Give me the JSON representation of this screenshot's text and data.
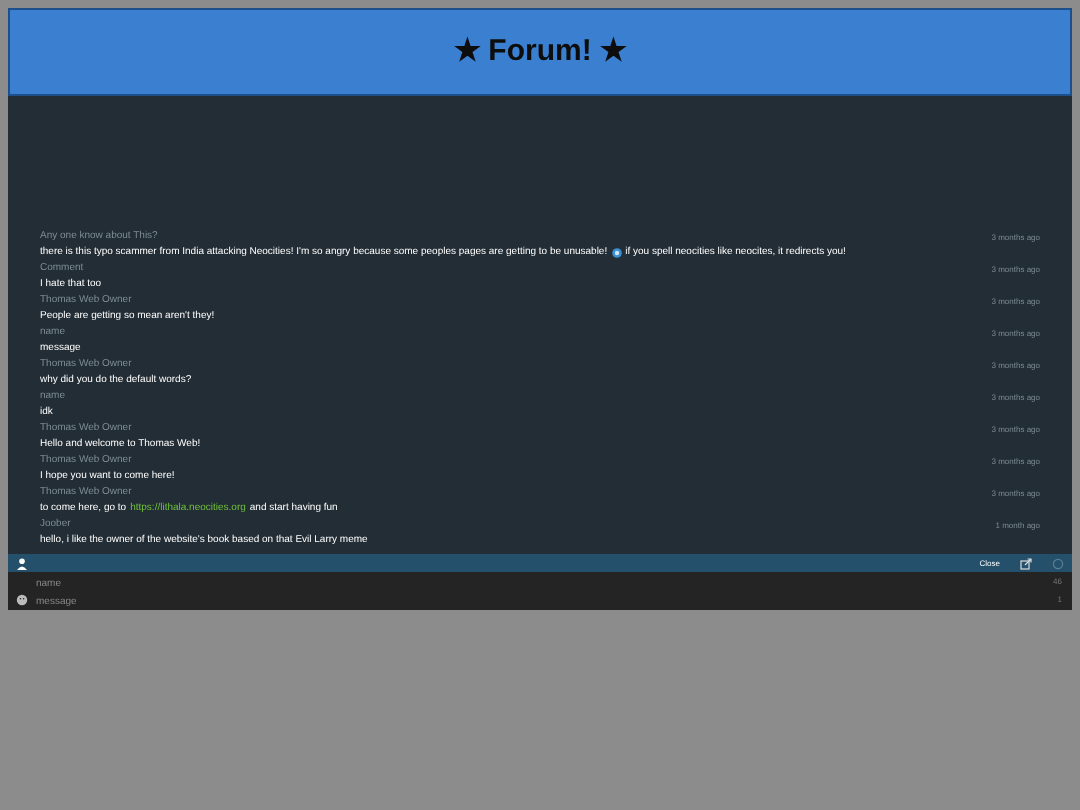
{
  "header": {
    "title": "★ Forum! ★"
  },
  "messages": [
    {
      "author": "Any one know about This?",
      "time": "3 months ago",
      "parts": [
        {
          "kind": "text",
          "text": "there is this typo scammer from India attacking Neocities! I'm so angry because some peoples pages are getting to be unusable!"
        },
        {
          "kind": "emoji"
        },
        {
          "kind": "text",
          "text": "if you spell neocities like neocites, it redirects you!"
        }
      ]
    },
    {
      "author": "Comment",
      "time": "3 months ago",
      "parts": [
        {
          "kind": "text",
          "text": "I hate that too"
        }
      ]
    },
    {
      "author": "Thomas Web Owner",
      "time": "3 months ago",
      "parts": [
        {
          "kind": "text",
          "text": "People are getting so mean aren't they!"
        }
      ]
    },
    {
      "author": "name",
      "time": "3 months ago",
      "parts": [
        {
          "kind": "text",
          "text": "message"
        }
      ]
    },
    {
      "author": "Thomas Web Owner",
      "time": "3 months ago",
      "parts": [
        {
          "kind": "text",
          "text": "why did you do the default words?"
        }
      ]
    },
    {
      "author": "name",
      "time": "3 months ago",
      "parts": [
        {
          "kind": "text",
          "text": "idk"
        }
      ]
    },
    {
      "author": "Thomas Web Owner",
      "time": "3 months ago",
      "parts": [
        {
          "kind": "text",
          "text": "Hello and welcome to Thomas Web!"
        }
      ]
    },
    {
      "author": "Thomas Web Owner",
      "time": "3 months ago",
      "parts": [
        {
          "kind": "text",
          "text": "I hope you want to come here!"
        }
      ]
    },
    {
      "author": "Thomas Web Owner",
      "time": "3 months ago",
      "parts": [
        {
          "kind": "text",
          "text": "to come here, go to"
        },
        {
          "kind": "link",
          "text": "https://lithala.neocities.org"
        },
        {
          "kind": "text",
          "text": "and start having fun"
        }
      ]
    },
    {
      "author": "Joober",
      "time": "1 month ago",
      "parts": [
        {
          "kind": "text",
          "text": "hello, i like the owner of the website's book based on that Evil Larry meme"
        }
      ]
    }
  ],
  "toolbar": {
    "close_label": "Close"
  },
  "form": {
    "name": {
      "placeholder": "name",
      "counter": "46"
    },
    "message": {
      "placeholder": "message",
      "counter": "1"
    }
  }
}
